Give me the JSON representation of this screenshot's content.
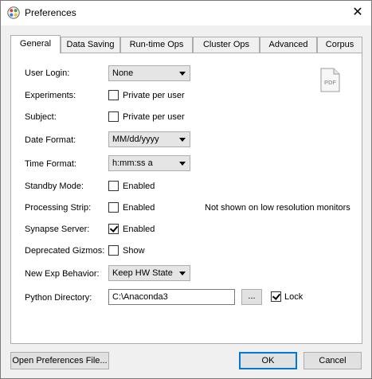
{
  "window": {
    "title": "Preferences",
    "close_label": "✕"
  },
  "tabs": [
    "General",
    "Data Saving",
    "Run-time Ops",
    "Cluster Ops",
    "Advanced",
    "Corpus"
  ],
  "general": {
    "user_login": {
      "label": "User Login:",
      "value": "None"
    },
    "experiments": {
      "label": "Experiments:",
      "checkbox_label": "Private per user",
      "checked": false
    },
    "subject": {
      "label": "Subject:",
      "checkbox_label": "Private per user",
      "checked": false
    },
    "date_format": {
      "label": "Date Format:",
      "value": "MM/dd/yyyy"
    },
    "time_format": {
      "label": "Time Format:",
      "value": "h:mm:ss a"
    },
    "standby_mode": {
      "label": "Standby Mode:",
      "checkbox_label": "Enabled",
      "checked": false
    },
    "processing_strip": {
      "label": "Processing Strip:",
      "checkbox_label": "Enabled",
      "checked": false,
      "note": "Not shown on low resolution monitors"
    },
    "synapse_server": {
      "label": "Synapse Server:",
      "checkbox_label": "Enabled",
      "checked": true
    },
    "deprecated_gizmos": {
      "label": "Deprecated Gizmos:",
      "checkbox_label": "Show",
      "checked": false
    },
    "new_exp_behavior": {
      "label": "New Exp Behavior:",
      "value": "Keep HW State"
    },
    "python_directory": {
      "label": "Python Directory:",
      "value": "C:\\Anaconda3",
      "browse_label": "...",
      "lock_label": "Lock",
      "lock_checked": true
    },
    "pdf_icon_text": "PDF"
  },
  "footer": {
    "open_prefs": "Open Preferences File...",
    "ok": "OK",
    "cancel": "Cancel"
  },
  "colors": {
    "accent": "#0078d7"
  }
}
